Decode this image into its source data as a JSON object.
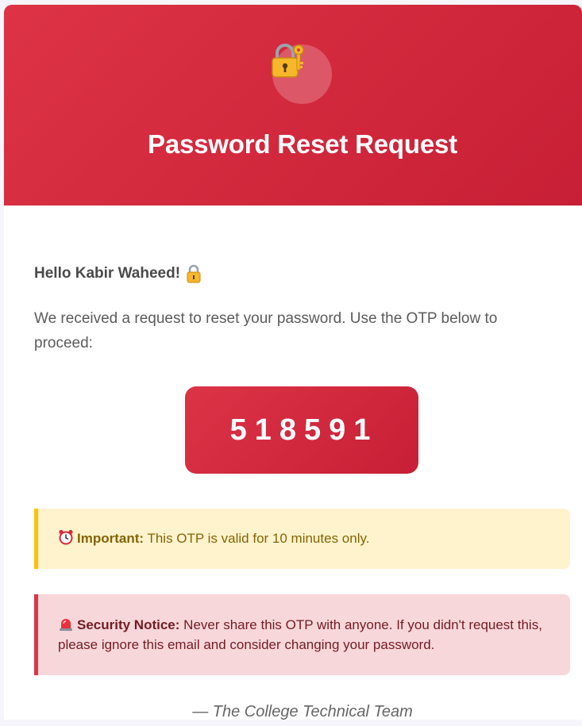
{
  "colors": {
    "brand_red": "#d42a3f",
    "important_bg": "#fff3cd",
    "important_border": "#ffc107",
    "security_bg": "#f8d7da",
    "security_border": "#dc3545"
  },
  "header": {
    "icon": "lock-with-key-icon",
    "title": "Password Reset Request"
  },
  "body": {
    "greeting": "Hello Kabir Waheed!",
    "greeting_icon": "lock-icon",
    "intro": "We received a request to reset your password. Use the OTP below to proceed:",
    "otp": "518591"
  },
  "notices": {
    "important": {
      "icon": "alarm-clock-icon",
      "label": "Important:",
      "text": " This OTP is valid for 10 minutes only."
    },
    "security": {
      "icon": "siren-icon",
      "label": "Security Notice:",
      "text": " Never share this OTP with anyone. If you didn't request this, please ignore this email and consider changing your password."
    }
  },
  "footer": {
    "signature": "— The College Technical Team"
  }
}
